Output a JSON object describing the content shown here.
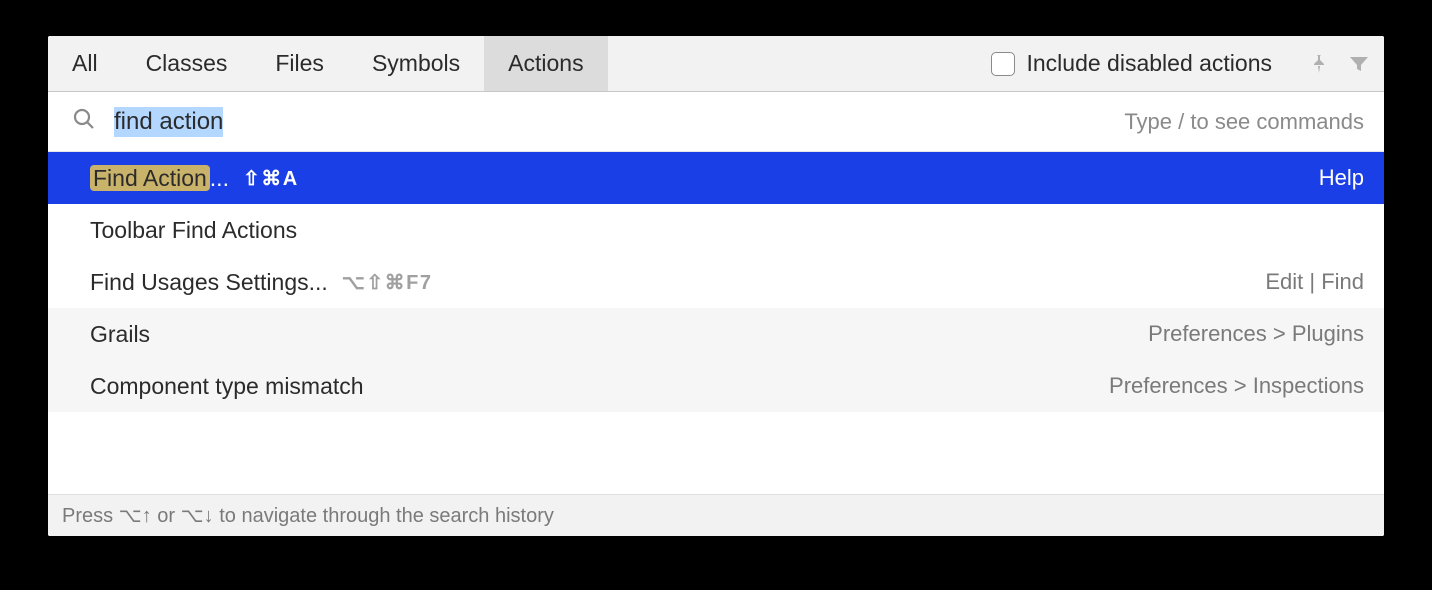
{
  "tabs": {
    "all": "All",
    "classes": "Classes",
    "files": "Files",
    "symbols": "Symbols",
    "actions": "Actions"
  },
  "toolbar": {
    "include_disabled": "Include disabled actions"
  },
  "search": {
    "query": "find action",
    "hint": "Type / to see commands"
  },
  "results": [
    {
      "label_hl": "Find Action",
      "label_suffix": "...",
      "shortcut": "⇧⌘A",
      "right": "Help",
      "selected": true
    },
    {
      "label": "Toolbar Find Actions",
      "right": ""
    },
    {
      "label": "Find Usages Settings...",
      "shortcut": "⌥⇧⌘F7",
      "shortcut_dim": true,
      "right": "Edit | Find"
    },
    {
      "label": "Grails",
      "right": "Preferences > Plugins",
      "alt": true
    },
    {
      "label": "Component type mismatch",
      "right": "Preferences > Inspections",
      "alt": true
    }
  ],
  "footer": "Press ⌥↑ or ⌥↓ to navigate through the search history"
}
